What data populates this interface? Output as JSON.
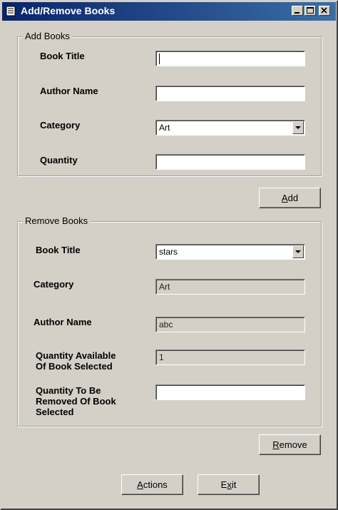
{
  "window": {
    "title": "Add/Remove Books"
  },
  "add_books": {
    "legend": "Add Books",
    "book_title_label": "Book Title",
    "book_title_value": "",
    "author_name_label": "Author Name",
    "author_name_value": "",
    "category_label": "Category",
    "category_value": "Art",
    "quantity_label": "Quantity",
    "quantity_value": "",
    "add_button": {
      "mnemonic": "A",
      "rest": "dd"
    }
  },
  "remove_books": {
    "legend": "Remove Books",
    "book_title_label": "Book Title",
    "book_title_value": "stars",
    "category_label": "Category",
    "category_value": "Art",
    "author_name_label": "Author Name",
    "author_name_value": "abc",
    "qty_available_label_line1": "Quantity Available",
    "qty_available_label_line2": "Of Book Selected",
    "qty_available_value": "1",
    "qty_remove_label_line1": "Quantity To Be",
    "qty_remove_label_line2": "Removed Of Book",
    "qty_remove_label_line3": "Selected",
    "qty_remove_value": "",
    "remove_button": {
      "mnemonic": "R",
      "rest": "emove"
    }
  },
  "footer": {
    "actions_button": {
      "mnemonic": "A",
      "rest": "ctions"
    },
    "exit_button": {
      "before": "E",
      "mnemonic": "x",
      "rest": "it"
    }
  },
  "icons": {
    "window_icon": "book-icon",
    "minimize": "minimize-icon",
    "maximize": "maximize-icon",
    "close": "close-icon",
    "dropdown": "chevron-down-icon"
  }
}
